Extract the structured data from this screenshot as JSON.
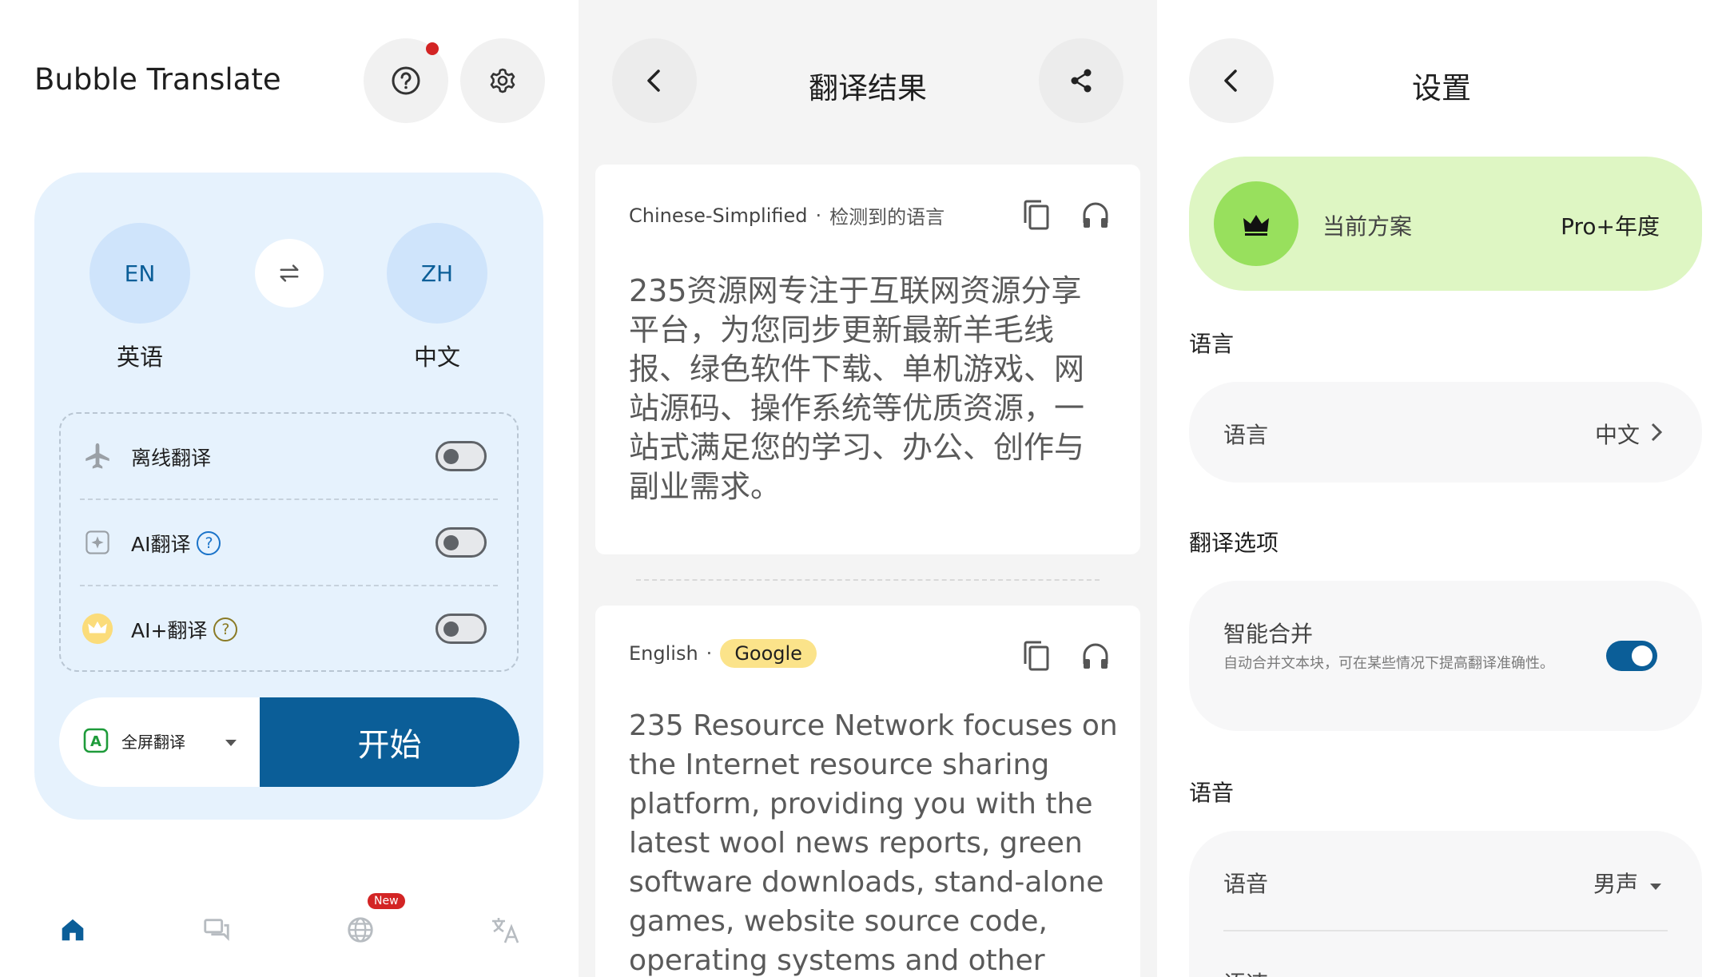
{
  "home": {
    "app_title": "Bubble Translate",
    "source_lang": {
      "code": "EN",
      "name": "英语"
    },
    "target_lang": {
      "code": "ZH",
      "name": "中文"
    },
    "options": [
      {
        "label": "离线翻译",
        "icon": "airplane-icon",
        "has_help": false,
        "enabled": false
      },
      {
        "label": "AI翻译",
        "icon": "sparkle-icon",
        "has_help": true,
        "enabled": false
      },
      {
        "label": "AI+翻译",
        "icon": "crown-badge-icon",
        "has_help": true,
        "enabled": false
      }
    ],
    "mode_label": "全屏翻译",
    "start_label": "开始",
    "nav": {
      "items": [
        "home-icon",
        "chat-icon",
        "globe-icon",
        "translate-icon"
      ],
      "new_badge": "New"
    }
  },
  "result": {
    "title": "翻译结果",
    "source": {
      "language": "Chinese-Simplified",
      "detected": "检测到的语言",
      "text": "235资源网专注于互联网资源分享平台，为您同步更新最新羊毛线报、绿色软件下载、单机游戏、网站源码、操作系统等优质资源，一站式满足您的学习、办公、创作与副业需求。"
    },
    "translation": {
      "language": "English",
      "engine": "Google",
      "text": "235 Resource Network focuses on the Internet resource sharing platform, providing you with the latest wool news reports, green software downloads, stand-alone games, website source code, operating systems and other"
    }
  },
  "settings": {
    "title": "设置",
    "plan": {
      "label": "当前方案",
      "value": "Pro+年度"
    },
    "sections": {
      "language": "语言",
      "translate_options": "翻译选项",
      "voice": "语音"
    },
    "language_row": {
      "label": "语言",
      "value": "中文"
    },
    "smart_merge": {
      "label": "智能合并",
      "desc": "自动合并文本块，可在某些情况下提高翻译准确性。",
      "enabled": true
    },
    "voice_row": {
      "label": "语音",
      "value": "男声"
    },
    "speed_row": {
      "label": "语速"
    }
  },
  "colors": {
    "brand": "#0b5e98",
    "card_blue": "#e6f2fd",
    "plan_green": "#def6c3",
    "badge_red": "#d32424",
    "chip_yellow": "#fbe38a"
  }
}
